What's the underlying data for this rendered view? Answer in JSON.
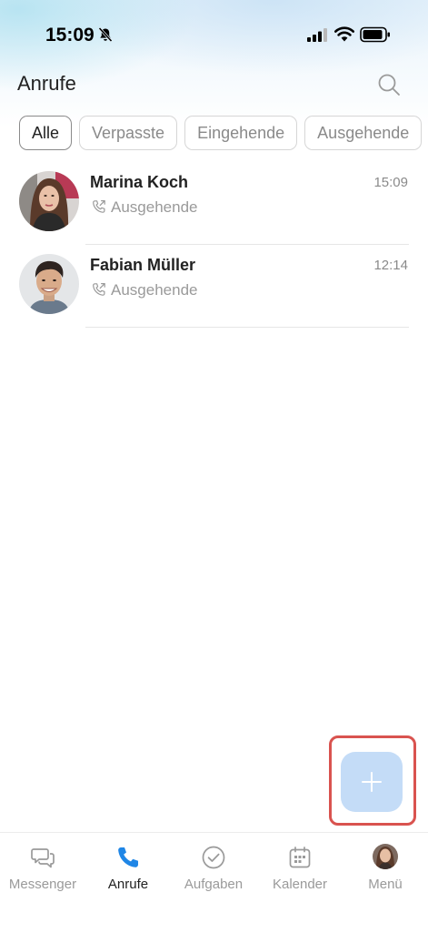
{
  "status_bar": {
    "time": "15:09"
  },
  "header": {
    "title": "Anrufe"
  },
  "filters": [
    {
      "label": "Alle",
      "active": true
    },
    {
      "label": "Verpasste",
      "active": false
    },
    {
      "label": "Eingehende",
      "active": false
    },
    {
      "label": "Ausgehende",
      "active": false
    }
  ],
  "calls": [
    {
      "name": "Marina Koch",
      "time": "15:09",
      "type": "Ausgehende",
      "type_icon": "outgoing-call-icon"
    },
    {
      "name": "Fabian Müller",
      "time": "12:14",
      "type": "Ausgehende",
      "type_icon": "outgoing-call-icon"
    }
  ],
  "fab": {
    "icon": "plus-icon",
    "color": "#c4dcf7",
    "highlight_color": "#d9534f"
  },
  "tab_bar": {
    "tabs": [
      {
        "label": "Messenger",
        "icon": "chat-bubbles-icon",
        "active": false
      },
      {
        "label": "Anrufe",
        "icon": "phone-icon",
        "active": true
      },
      {
        "label": "Aufgaben",
        "icon": "check-circle-icon",
        "active": false
      },
      {
        "label": "Kalender",
        "icon": "calendar-icon",
        "active": false
      },
      {
        "label": "Menü",
        "icon": "avatar",
        "active": false
      }
    ]
  },
  "colors": {
    "accent": "#1f86e6",
    "muted_text": "#9a9a9a"
  }
}
